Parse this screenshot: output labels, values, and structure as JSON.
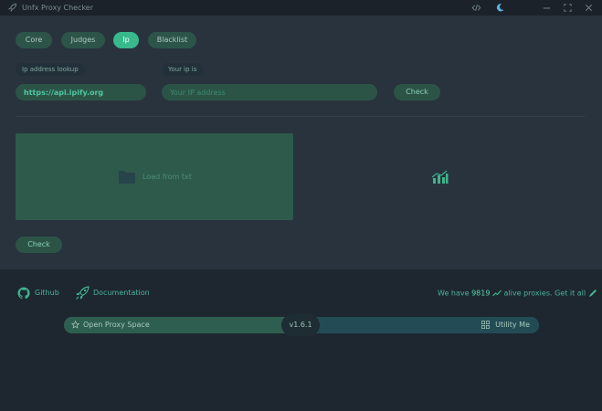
{
  "window": {
    "title": "Unfx Proxy Checker",
    "controls": [
      "code-icon",
      "moon-icon",
      "minimize-icon",
      "maximize-icon",
      "close-icon"
    ]
  },
  "tabs": [
    {
      "label": "Core",
      "active": false
    },
    {
      "label": "Judges",
      "active": false
    },
    {
      "label": "Ip",
      "active": true
    },
    {
      "label": "Blacklist",
      "active": false
    }
  ],
  "ip": {
    "lookup_label": "Ip address lookup",
    "lookup_value": "https://api.ipify.org",
    "your_ip_label": "Your ip is",
    "your_ip_placeholder": "Your IP address",
    "check_label": "Check"
  },
  "input_panel": {
    "load_label": "Load from txt",
    "check_label": "Check"
  },
  "footer": {
    "github_label": "Github",
    "docs_label": "Documentation",
    "alive_prefix": "We have",
    "alive_count": "9819",
    "alive_suffix": "alive proxies. Get it all",
    "bar": {
      "left_label": "Open Proxy Space",
      "version": "v1.6.1",
      "right_label": "Utility Me"
    }
  },
  "colors": {
    "accent": "#38b98c",
    "background": "#1e2730",
    "panel": "#28333d"
  }
}
